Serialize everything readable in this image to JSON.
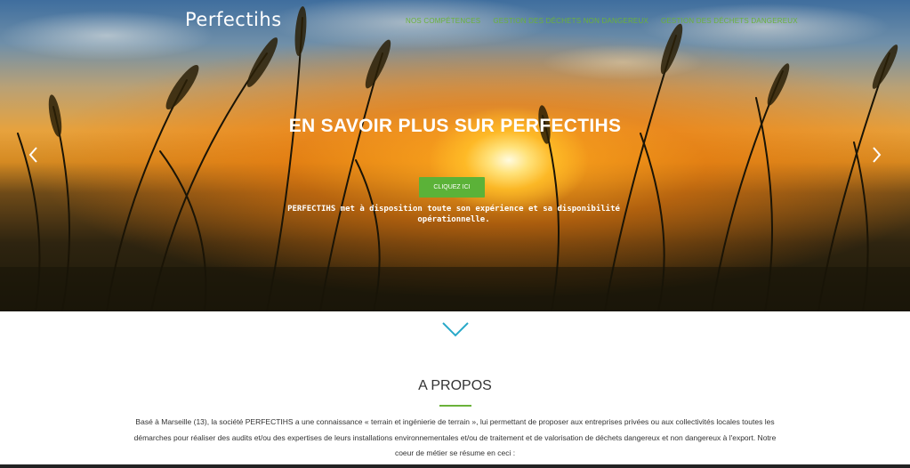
{
  "brand": {
    "name": "Perfectihs"
  },
  "nav": {
    "items": [
      {
        "label": "Nos compétences"
      },
      {
        "label": "Gestion des déchets non dangereux"
      },
      {
        "label": "Gestion des déchets dangereux"
      }
    ]
  },
  "hero": {
    "title": "EN SAVOIR PLUS SUR PERFECTIHS",
    "button_label": "CLIQUEZ ICI",
    "subtitle": "PERFECTIHS met à disposition toute son expérience et sa disponibilité opérationnelle.",
    "prev_icon": "chevron-left-icon",
    "next_icon": "chevron-right-icon"
  },
  "colors": {
    "accent": "#6ab23a",
    "button": "#5bb238",
    "chevron": "#29a9c9"
  },
  "about": {
    "scroll_icon": "chevron-down-icon",
    "title": "A PROPOS",
    "text": "Basé à Marseille (13), la société PERFECTIHS a une connaissance « terrain et ingénierie de terrain », lui permettant de proposer aux entreprises privées ou aux collectivités locales toutes les démarches pour réaliser des audits et/ou des expertises de leurs installations environnementales et/ou de traitement et de valorisation de déchets dangereux et non dangereux à l'export. Notre coeur de métier se résume en ceci :"
  }
}
